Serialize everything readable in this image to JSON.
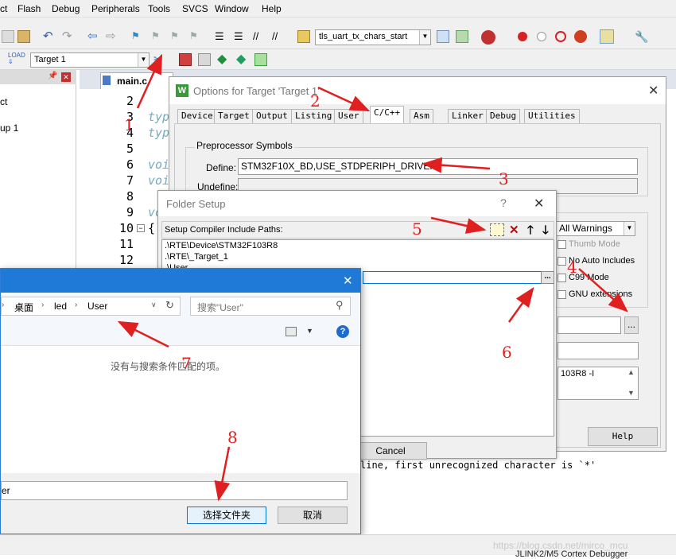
{
  "menu": [
    "ct",
    "Flash",
    "Debug",
    "Peripherals",
    "Tools",
    "SVCS",
    "Window",
    "Help"
  ],
  "toolbar": {
    "target_combo": "tls_uart_tx_chars_start",
    "target_select": "Target 1"
  },
  "project_panel": {
    "item": "up 1"
  },
  "editor": {
    "tab": "main.c",
    "line_numbers": [
      "2",
      "3",
      "4",
      "5",
      "6",
      "7",
      "8",
      "9",
      "10",
      "11",
      "12"
    ],
    "code_fragments": [
      "typ",
      "typ",
      "voi",
      "voi",
      "vo",
      "{"
    ]
  },
  "options_dialog": {
    "title": "Options for Target 'Target 1'",
    "tabs": [
      "Device",
      "Target",
      "Output",
      "Listing",
      "User",
      "C/C++",
      "Asm",
      "Linker",
      "Debug",
      "Utilities"
    ],
    "active_tab": "C/C++",
    "preprocessor_label": "Preprocessor Symbols",
    "define_label": "Define:",
    "define_value": "STM32F10X_BD,USE_STDPERIPH_DRIVER",
    "undefine_label": "Undefine:",
    "warnings_value": "All Warnings",
    "thumb_mode": "Thumb Mode",
    "no_auto_includes": "No Auto Includes",
    "c99_mode": "C99 Mode",
    "gnu_extensions": "GNU extensions",
    "misc_text": "103R8 -I",
    "help_button": "Help",
    "browse_button": "..."
  },
  "folder_setup": {
    "title": "Folder Setup",
    "question": "?",
    "paths_label": "Setup Compiler Include Paths:",
    "paths": [
      ".\\RTE\\Device\\STM32F103R8",
      ".\\RTE\\_Target_1",
      ".\\User"
    ],
    "browse_button": "...",
    "cancel_button": "Cancel"
  },
  "browse_dialog": {
    "breadcrumb": [
      "桌面",
      "led",
      "User"
    ],
    "search_placeholder": "搜索\"User\"",
    "empty_message": "没有与搜索条件匹配的项。",
    "folder_value": "er",
    "select_button": "选择文件夹",
    "cancel_button": "取消"
  },
  "build_output": "line, first unrecognized character is `*'",
  "status_bar": {
    "debugger": "JLINK2/M5 Cortex Debugger",
    "watermark": "https://blog.csdn.net/mirco_mcu"
  },
  "annotations": [
    "1",
    "2",
    "3",
    "4",
    "5",
    "6",
    "7",
    "8"
  ],
  "colors": {
    "annotation": "#e02020",
    "title_blue": "#1e7ad6",
    "selection": "#0078d7"
  }
}
